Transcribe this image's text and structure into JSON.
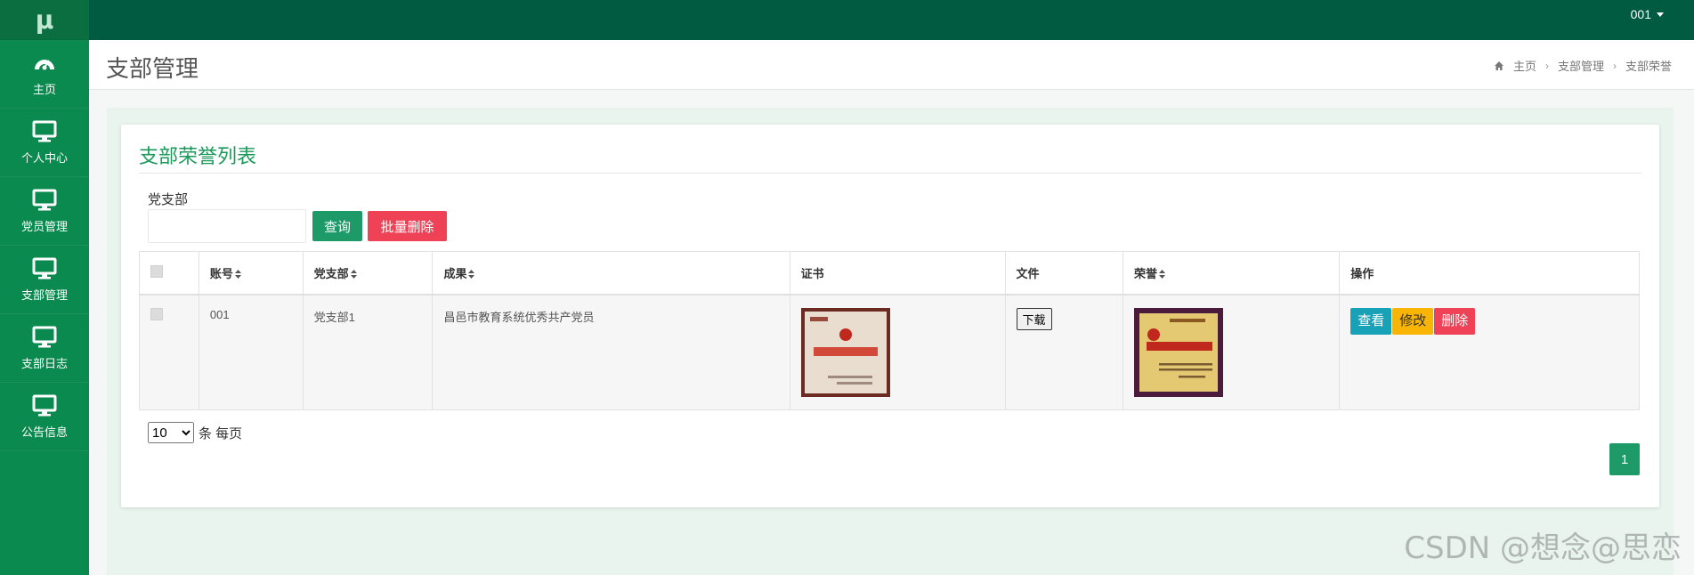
{
  "brand": {
    "logo_text": "μ"
  },
  "sidebar": {
    "items": [
      {
        "label": "主页",
        "icon": "dashboard-icon"
      },
      {
        "label": "个人中心",
        "icon": "monitor-icon"
      },
      {
        "label": "党员管理",
        "icon": "monitor-icon"
      },
      {
        "label": "支部管理",
        "icon": "monitor-icon"
      },
      {
        "label": "支部日志",
        "icon": "monitor-icon"
      },
      {
        "label": "公告信息",
        "icon": "monitor-icon"
      }
    ]
  },
  "topbar": {
    "user": "001"
  },
  "header": {
    "title": "支部管理",
    "breadcrumb": [
      "主页",
      "支部管理",
      "支部荣誉"
    ]
  },
  "card": {
    "title": "支部荣誉列表",
    "filter_label": "党支部",
    "filter_value": "",
    "query_label": "查询",
    "batch_delete_label": "批量删除"
  },
  "table": {
    "columns": [
      "账号",
      "党支部",
      "成果",
      "证书",
      "文件",
      "荣誉",
      "操作"
    ],
    "rows": [
      {
        "account": "001",
        "branch": "党支部1",
        "achievement": "昌邑市教育系统优秀共产党员",
        "download_label": "下载",
        "view_label": "查看",
        "edit_label": "修改",
        "delete_label": "删除"
      }
    ]
  },
  "pagination": {
    "page_size": "10",
    "page_size_suffix": "条 每页",
    "current_page": "1"
  },
  "watermark": "CSDN @想念@思恋",
  "colors": {
    "sidebar": "#0a8a4e",
    "topbar": "#005b40",
    "accent": "#1e9968",
    "danger": "#f04256",
    "info": "#17a2b8",
    "warning": "#f8b505"
  }
}
